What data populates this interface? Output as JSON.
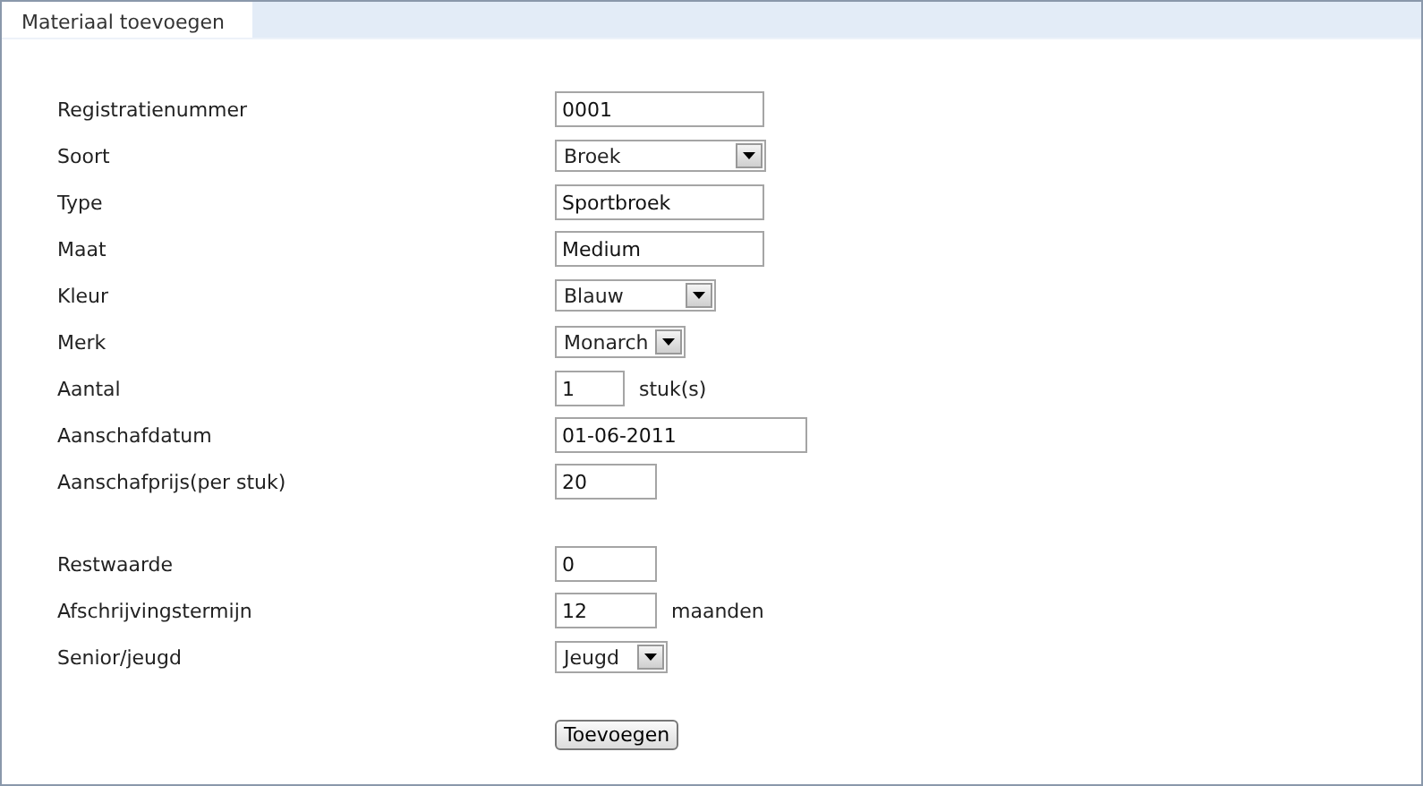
{
  "tabs": [
    {
      "label": "Materiaal toevoegen",
      "selected": true
    }
  ],
  "sections": [
    [
      {
        "label": "Registratienummer",
        "kind": "text",
        "value": "0001"
      },
      {
        "label": "Soort",
        "kind": "select",
        "value": "Broek"
      },
      {
        "label": "Type",
        "kind": "text",
        "value": "Sportbroek"
      },
      {
        "label": "Maat",
        "kind": "text",
        "value": "Medium"
      },
      {
        "label": "Kleur",
        "kind": "select",
        "value": "Blauw"
      },
      {
        "label": "Merk",
        "kind": "select",
        "value": "Monarch"
      },
      {
        "label": "Aantal",
        "kind": "text",
        "value": "1",
        "suffix": "stuk(s)"
      },
      {
        "label": "Aanschafdatum",
        "kind": "text",
        "value": "01-06-2011"
      },
      {
        "label": "Aanschafprijs(per stuk)",
        "kind": "text",
        "value": "20"
      }
    ],
    [
      {
        "label": "Restwaarde",
        "kind": "text",
        "value": "0"
      },
      {
        "label": "Afschrijvingstermijn",
        "kind": "text",
        "value": "12",
        "suffix": "maanden"
      },
      {
        "label": "Senior/jeugd",
        "kind": "select",
        "value": "Jeugd"
      }
    ]
  ],
  "submit": "Toevoegen"
}
